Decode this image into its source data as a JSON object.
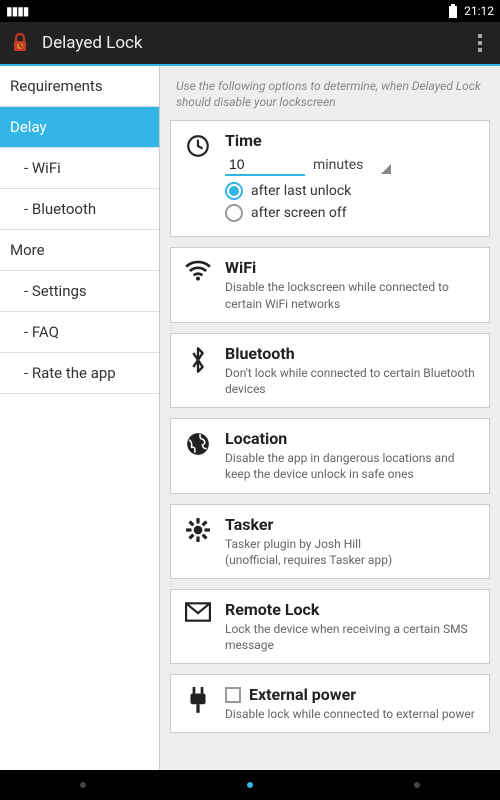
{
  "statusbar": {
    "time": "21:12"
  },
  "actionbar": {
    "title": "Delayed Lock"
  },
  "sidebar": {
    "items": [
      {
        "label": "Requirements",
        "type": "header"
      },
      {
        "label": "Delay",
        "type": "header",
        "selected": true
      },
      {
        "label": "- WiFi",
        "type": "sub"
      },
      {
        "label": "- Bluetooth",
        "type": "sub"
      },
      {
        "label": "More",
        "type": "header"
      },
      {
        "label": "- Settings",
        "type": "sub"
      },
      {
        "label": "- FAQ",
        "type": "sub"
      },
      {
        "label": "- Rate the app",
        "type": "sub"
      }
    ]
  },
  "main": {
    "hint": "Use the following options to determine, when Delayed Lock should disable your lockscreen",
    "time": {
      "title": "Time",
      "value": "10",
      "unit": "minutes",
      "option1": "after last unlock",
      "option2": "after screen off"
    },
    "wifi": {
      "title": "WiFi",
      "desc": "Disable the lockscreen while connected to certain WiFi networks"
    },
    "bluetooth": {
      "title": "Bluetooth",
      "desc": "Don't lock while connected to certain Bluetooth devices"
    },
    "location": {
      "title": "Location",
      "desc": "Disable the app in dangerous locations and keep the device unlock in safe ones"
    },
    "tasker": {
      "title": "Tasker",
      "desc": "Tasker plugin by Josh Hill\n(unofficial, requires Tasker app)"
    },
    "remote": {
      "title": "Remote Lock",
      "desc": "Lock the device when receiving a certain SMS message"
    },
    "power": {
      "title": "External power",
      "desc": "Disable lock while connected to external power"
    }
  }
}
